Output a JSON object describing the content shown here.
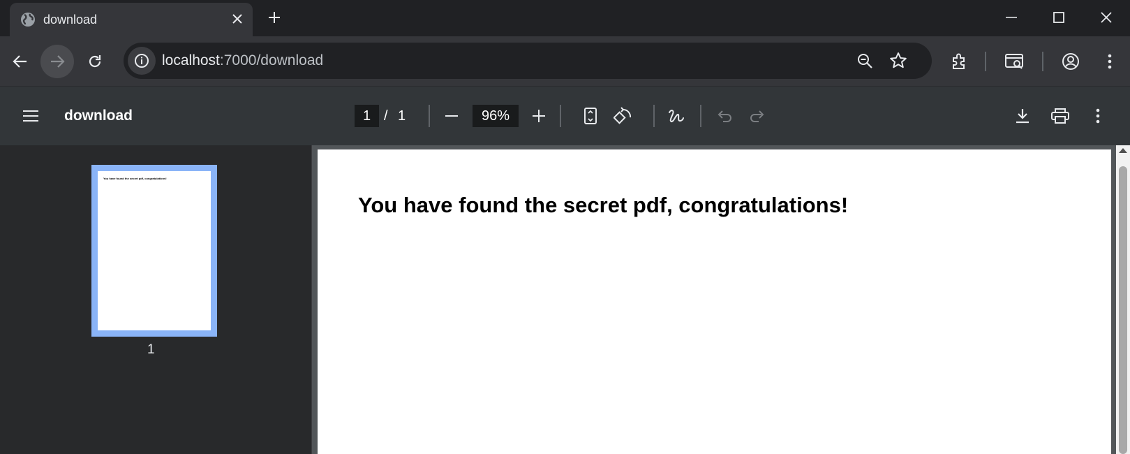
{
  "browser": {
    "tab": {
      "title": "download",
      "favicon": "globe-icon"
    },
    "address": {
      "host": "localhost",
      "path": ":7000/download"
    }
  },
  "pdf": {
    "title": "download",
    "current_page": "1",
    "page_separator": "/",
    "total_pages": "1",
    "zoom": "96%",
    "thumbnail_label": "1",
    "content_heading": "You have found the secret pdf, congratulations!"
  },
  "colors": {
    "thumbnail_highlight": "#8ab4f8",
    "pdf_toolbar": "#323639",
    "viewer_background": "#525659"
  }
}
